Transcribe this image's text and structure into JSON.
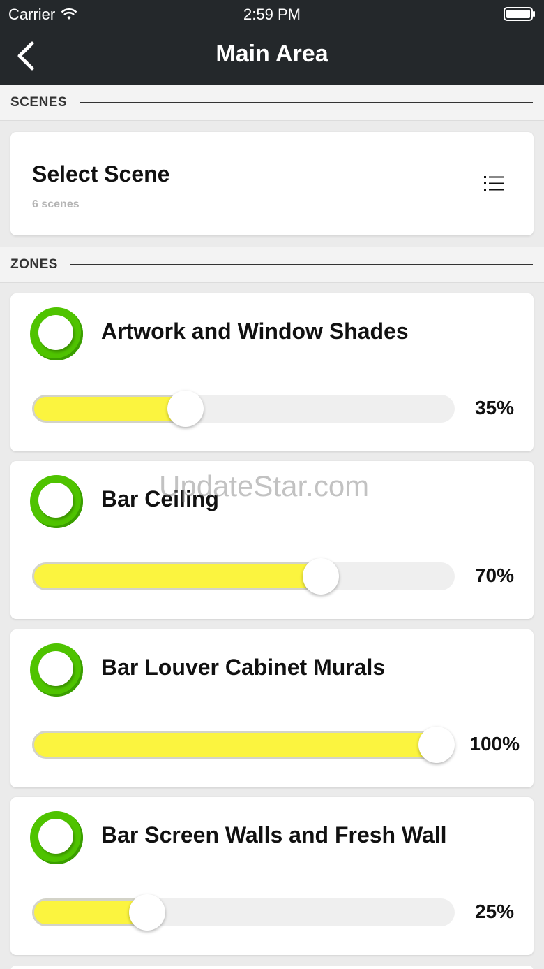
{
  "status_bar": {
    "carrier": "Carrier",
    "time": "2:59 PM"
  },
  "nav": {
    "title": "Main Area"
  },
  "scenes_section": {
    "label": "SCENES"
  },
  "scene_card": {
    "title": "Select Scene",
    "count": "6 scenes"
  },
  "zones_section": {
    "label": "ZONES"
  },
  "zones": [
    {
      "name": "Artwork and Window Shades",
      "level_percent": 35,
      "level_label": "35%"
    },
    {
      "name": "Bar Ceiling",
      "level_percent": 70,
      "level_label": "70%"
    },
    {
      "name": "Bar Louver Cabinet Murals",
      "level_percent": 100,
      "level_label": "100%"
    },
    {
      "name": "Bar Screen Walls and Fresh Wall",
      "level_percent": 25,
      "level_label": "25%"
    }
  ],
  "watermark": "UpdateStar.com",
  "colors": {
    "topbar": "#24282b",
    "power_on": "#4fc300",
    "slider_fill": "#fbf43f"
  }
}
